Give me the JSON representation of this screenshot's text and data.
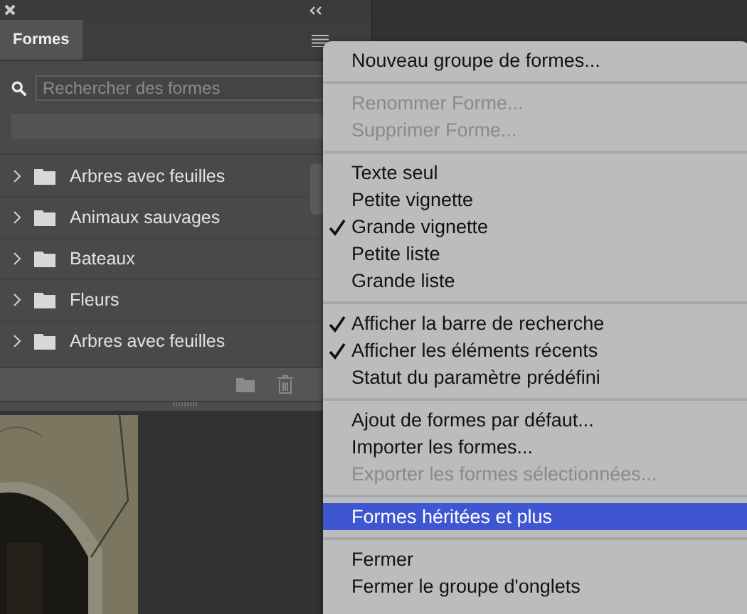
{
  "panel": {
    "tabs": [
      {
        "label": "Formes",
        "selected": true
      }
    ],
    "search": {
      "placeholder": "Rechercher des formes"
    },
    "groups": [
      {
        "label": "Arbres avec feuilles",
        "expanded": false
      },
      {
        "label": "Animaux sauvages",
        "expanded": false
      },
      {
        "label": "Bateaux",
        "expanded": false
      },
      {
        "label": "Fleurs",
        "expanded": false
      },
      {
        "label": "Arbres avec feuilles",
        "expanded": false
      }
    ]
  },
  "menu": {
    "sections": [
      [
        {
          "label": "Nouveau groupe de formes...",
          "disabled": false,
          "checked": false,
          "selected": false
        }
      ],
      [
        {
          "label": "Renommer Forme...",
          "disabled": true,
          "checked": false,
          "selected": false
        },
        {
          "label": "Supprimer Forme...",
          "disabled": true,
          "checked": false,
          "selected": false
        }
      ],
      [
        {
          "label": "Texte seul",
          "disabled": false,
          "checked": false,
          "selected": false
        },
        {
          "label": "Petite vignette",
          "disabled": false,
          "checked": false,
          "selected": false
        },
        {
          "label": "Grande vignette",
          "disabled": false,
          "checked": true,
          "selected": false
        },
        {
          "label": "Petite liste",
          "disabled": false,
          "checked": false,
          "selected": false
        },
        {
          "label": "Grande liste",
          "disabled": false,
          "checked": false,
          "selected": false
        }
      ],
      [
        {
          "label": "Afficher la barre de recherche",
          "disabled": false,
          "checked": true,
          "selected": false
        },
        {
          "label": "Afficher les éléments récents",
          "disabled": false,
          "checked": true,
          "selected": false
        },
        {
          "label": "Statut du paramètre prédéfini",
          "disabled": false,
          "checked": false,
          "selected": false
        }
      ],
      [
        {
          "label": "Ajout de formes par défaut...",
          "disabled": false,
          "checked": false,
          "selected": false
        },
        {
          "label": "Importer les formes...",
          "disabled": false,
          "checked": false,
          "selected": false
        },
        {
          "label": "Exporter les formes sélectionnées...",
          "disabled": true,
          "checked": false,
          "selected": false
        }
      ],
      [
        {
          "label": "Formes héritées et plus",
          "disabled": false,
          "checked": false,
          "selected": true
        }
      ],
      [
        {
          "label": "Fermer",
          "disabled": false,
          "checked": false,
          "selected": false
        },
        {
          "label": "Fermer le groupe d'onglets",
          "disabled": false,
          "checked": false,
          "selected": false
        }
      ]
    ]
  }
}
